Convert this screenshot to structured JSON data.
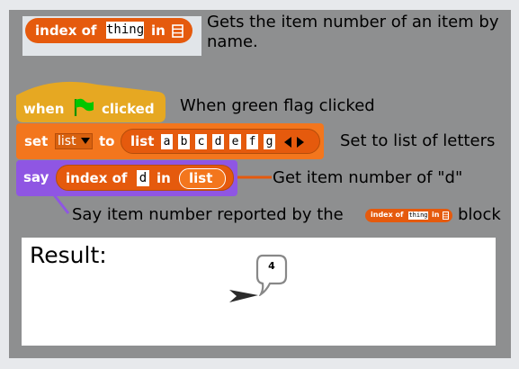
{
  "top": {
    "block": {
      "keyword": "index of",
      "input": "thing",
      "in_label": "in",
      "list_icon": "list-icon"
    },
    "description": "Gets the item number of an item by\nname."
  },
  "script": {
    "hat": {
      "when_label": "when",
      "flag_icon": "green-flag-icon",
      "clicked_label": "clicked"
    },
    "hat_note": "When green flag clicked",
    "set_block": {
      "set_label": "set",
      "var_name": "list",
      "to_label": "to",
      "list_label": "list",
      "items": [
        "a",
        "b",
        "c",
        "d",
        "e",
        "f",
        "g"
      ],
      "arrows_icon": "left-right-arrows-icon"
    },
    "set_note": "Set to list of letters",
    "say_block": {
      "say_label": "say",
      "index_of_label": "index of",
      "input": "d",
      "in_label": "in",
      "list_var": "list"
    },
    "say_note_right": "Get item number of \"d\"",
    "say_note_bottom_prefix": "Say item number reported by the",
    "say_note_bottom_mini": {
      "keyword": "index of",
      "input": "thing",
      "in_label": "in"
    },
    "say_note_bottom_suffix": "block"
  },
  "result": {
    "title": "Result:",
    "speech_value": "4",
    "sprite_icon": "arrow-sprite-icon"
  },
  "colors": {
    "operators_orange": "#e55a0d",
    "control_yellow": "#e6a822",
    "variables_orange": "#f3761d",
    "looks_purple": "#8f56e3",
    "flag_green": "#00c700",
    "panel_gray": "#8e8f90"
  }
}
